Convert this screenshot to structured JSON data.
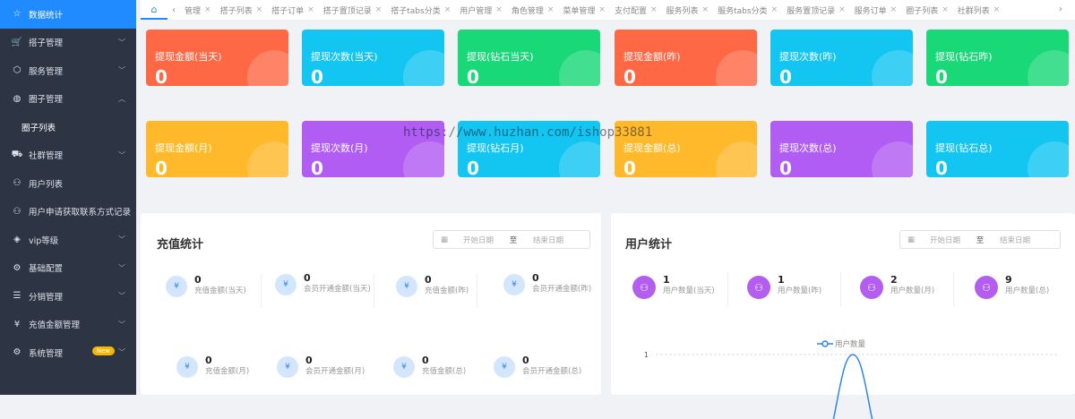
{
  "sidebar": {
    "items": [
      {
        "label": "数据统计",
        "icon": "star-icon",
        "active": true,
        "caret": ""
      },
      {
        "label": "搭子管理",
        "icon": "cart-icon",
        "caret": "⌄"
      },
      {
        "label": "服务管理",
        "icon": "box-icon",
        "caret": "⌄"
      },
      {
        "label": "圈子管理",
        "icon": "palette-icon",
        "caret": "⌃"
      },
      {
        "label": "圈子列表",
        "sub": true
      },
      {
        "label": "社群管理",
        "icon": "truck-icon",
        "caret": "⌄"
      },
      {
        "label": "用户列表",
        "icon": "users-icon"
      },
      {
        "label": "用户申请获取联系方式记录",
        "icon": "users-icon"
      },
      {
        "label": "vip等级",
        "icon": "cube-icon",
        "caret": "⌄"
      },
      {
        "label": "基础配置",
        "icon": "gears-icon",
        "caret": "⌄"
      },
      {
        "label": "分销管理",
        "icon": "list-icon",
        "caret": "⌄"
      },
      {
        "label": "充值金额管理",
        "icon": "yen-icon",
        "caret": "⌄"
      },
      {
        "label": "系统管理",
        "icon": "gear-icon",
        "caret": "⌄",
        "badge": "New"
      }
    ]
  },
  "tabs": [
    "管理",
    "搭子列表",
    "搭子订单",
    "搭子置顶记录",
    "搭子tabs分类",
    "用户管理",
    "角色管理",
    "菜单管理",
    "支付配置",
    "服务列表",
    "服务tabs分类",
    "服务置顶记录",
    "服务订单",
    "圈子列表",
    "社群列表"
  ],
  "cards_row1": [
    {
      "title": "提现金额(当天)",
      "value": "0",
      "color": "#ff6845"
    },
    {
      "title": "提现次数(当天)",
      "value": "0",
      "color": "#13c6f2"
    },
    {
      "title": "提现(钻石当天)",
      "value": "0",
      "color": "#19d878"
    },
    {
      "title": "提现金额(昨)",
      "value": "0",
      "color": "#ff6845"
    },
    {
      "title": "提现次数(昨)",
      "value": "0",
      "color": "#13c6f2"
    },
    {
      "title": "提现(钻石昨)",
      "value": "0",
      "color": "#19d878"
    }
  ],
  "cards_row2": [
    {
      "title": "提现金额(月)",
      "value": "0",
      "color": "#ffb92a"
    },
    {
      "title": "提现次数(月)",
      "value": "0",
      "color": "#b15cf3"
    },
    {
      "title": "提现(钻石月)",
      "value": "0",
      "color": "#13c6f2"
    },
    {
      "title": "提现金额(总)",
      "value": "0",
      "color": "#ffb92a"
    },
    {
      "title": "提现次数(总)",
      "value": "0",
      "color": "#b15cf3"
    },
    {
      "title": "提现(钻石总)",
      "value": "0",
      "color": "#13c6f2"
    }
  ],
  "recharge": {
    "title": "充值统计",
    "start_placeholder": "开始日期",
    "end_placeholder": "结束日期",
    "sep": "至",
    "stats": [
      {
        "num": "0",
        "label": "充值金额(当天)"
      },
      {
        "num": "0",
        "label": "会员开通金额(当天)"
      },
      {
        "num": "0",
        "label": "充值金额(昨)"
      },
      {
        "num": "0",
        "label": "会员开通金额(昨)"
      },
      {
        "num": "0",
        "label": "充值金额(月)"
      },
      {
        "num": "0",
        "label": "会员开通金额(月)"
      },
      {
        "num": "0",
        "label": "充值金额(总)"
      },
      {
        "num": "0",
        "label": "会员开通金额(总)"
      }
    ]
  },
  "users": {
    "title": "用户统计",
    "start_placeholder": "开始日期",
    "end_placeholder": "结束日期",
    "sep": "至",
    "stats": [
      {
        "num": "1",
        "label": "用户数量(当天)"
      },
      {
        "num": "1",
        "label": "用户数量(昨)"
      },
      {
        "num": "2",
        "label": "用户数量(月)"
      },
      {
        "num": "9",
        "label": "用户数量(总)"
      }
    ]
  },
  "chart_data": {
    "type": "line",
    "series": [
      {
        "name": "用户数量"
      }
    ],
    "yticks": [
      "1"
    ],
    "line_color": "#2e85e8"
  },
  "watermark": "https://www.huzhan.com/ishop33881"
}
